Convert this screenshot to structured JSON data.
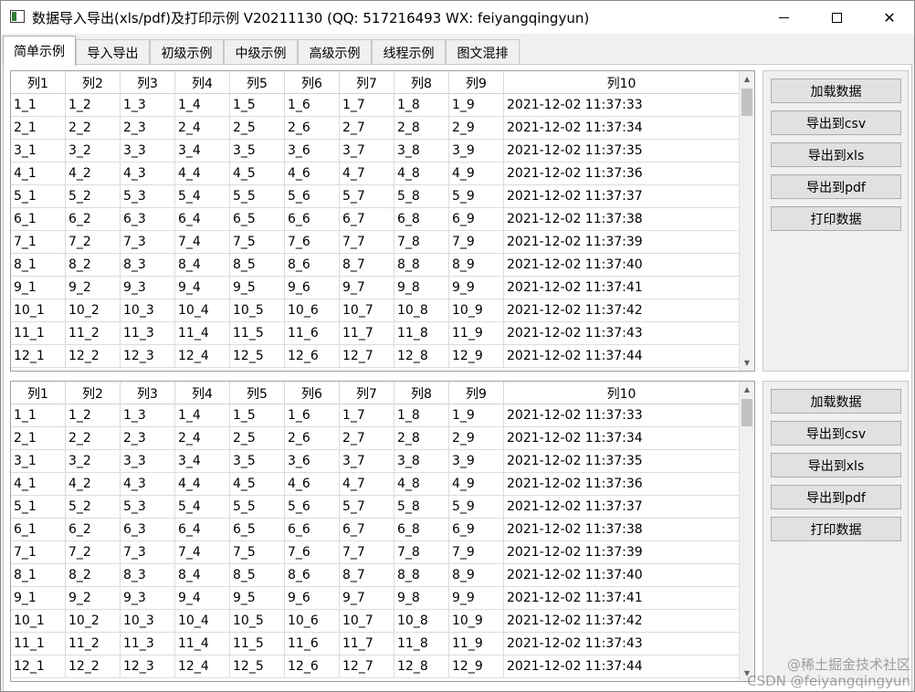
{
  "window": {
    "title": "数据导入导出(xls/pdf)及打印示例 V20211130 (QQ: 517216493 WX: feiyangqingyun)",
    "icon": "app-window-icon",
    "controls": {
      "minimize": "minimize-icon",
      "maximize": "maximize-icon",
      "close": "✕"
    }
  },
  "tabs": [
    {
      "label": "简单示例",
      "active": true
    },
    {
      "label": "导入导出",
      "active": false
    },
    {
      "label": "初级示例",
      "active": false
    },
    {
      "label": "中级示例",
      "active": false
    },
    {
      "label": "高级示例",
      "active": false
    },
    {
      "label": "线程示例",
      "active": false
    },
    {
      "label": "图文混排",
      "active": false
    }
  ],
  "tables": [
    {
      "columns": [
        "列1",
        "列2",
        "列3",
        "列4",
        "列5",
        "列6",
        "列7",
        "列8",
        "列9",
        "列10"
      ],
      "rows": [
        [
          "1_1",
          "1_2",
          "1_3",
          "1_4",
          "1_5",
          "1_6",
          "1_7",
          "1_8",
          "1_9",
          "2021-12-02 11:37:33"
        ],
        [
          "2_1",
          "2_2",
          "2_3",
          "2_4",
          "2_5",
          "2_6",
          "2_7",
          "2_8",
          "2_9",
          "2021-12-02 11:37:34"
        ],
        [
          "3_1",
          "3_2",
          "3_3",
          "3_4",
          "3_5",
          "3_6",
          "3_7",
          "3_8",
          "3_9",
          "2021-12-02 11:37:35"
        ],
        [
          "4_1",
          "4_2",
          "4_3",
          "4_4",
          "4_5",
          "4_6",
          "4_7",
          "4_8",
          "4_9",
          "2021-12-02 11:37:36"
        ],
        [
          "5_1",
          "5_2",
          "5_3",
          "5_4",
          "5_5",
          "5_6",
          "5_7",
          "5_8",
          "5_9",
          "2021-12-02 11:37:37"
        ],
        [
          "6_1",
          "6_2",
          "6_3",
          "6_4",
          "6_5",
          "6_6",
          "6_7",
          "6_8",
          "6_9",
          "2021-12-02 11:37:38"
        ],
        [
          "7_1",
          "7_2",
          "7_3",
          "7_4",
          "7_5",
          "7_6",
          "7_7",
          "7_8",
          "7_9",
          "2021-12-02 11:37:39"
        ],
        [
          "8_1",
          "8_2",
          "8_3",
          "8_4",
          "8_5",
          "8_6",
          "8_7",
          "8_8",
          "8_9",
          "2021-12-02 11:37:40"
        ],
        [
          "9_1",
          "9_2",
          "9_3",
          "9_4",
          "9_5",
          "9_6",
          "9_7",
          "9_8",
          "9_9",
          "2021-12-02 11:37:41"
        ],
        [
          "10_1",
          "10_2",
          "10_3",
          "10_4",
          "10_5",
          "10_6",
          "10_7",
          "10_8",
          "10_9",
          "2021-12-02 11:37:42"
        ],
        [
          "11_1",
          "11_2",
          "11_3",
          "11_4",
          "11_5",
          "11_6",
          "11_7",
          "11_8",
          "11_9",
          "2021-12-02 11:37:43"
        ],
        [
          "12_1",
          "12_2",
          "12_3",
          "12_4",
          "12_5",
          "12_6",
          "12_7",
          "12_8",
          "12_9",
          "2021-12-02 11:37:44"
        ]
      ],
      "buttons": [
        "加载数据",
        "导出到csv",
        "导出到xls",
        "导出到pdf",
        "打印数据"
      ]
    },
    {
      "columns": [
        "列1",
        "列2",
        "列3",
        "列4",
        "列5",
        "列6",
        "列7",
        "列8",
        "列9",
        "列10"
      ],
      "rows": [
        [
          "1_1",
          "1_2",
          "1_3",
          "1_4",
          "1_5",
          "1_6",
          "1_7",
          "1_8",
          "1_9",
          "2021-12-02 11:37:33"
        ],
        [
          "2_1",
          "2_2",
          "2_3",
          "2_4",
          "2_5",
          "2_6",
          "2_7",
          "2_8",
          "2_9",
          "2021-12-02 11:37:34"
        ],
        [
          "3_1",
          "3_2",
          "3_3",
          "3_4",
          "3_5",
          "3_6",
          "3_7",
          "3_8",
          "3_9",
          "2021-12-02 11:37:35"
        ],
        [
          "4_1",
          "4_2",
          "4_3",
          "4_4",
          "4_5",
          "4_6",
          "4_7",
          "4_8",
          "4_9",
          "2021-12-02 11:37:36"
        ],
        [
          "5_1",
          "5_2",
          "5_3",
          "5_4",
          "5_5",
          "5_6",
          "5_7",
          "5_8",
          "5_9",
          "2021-12-02 11:37:37"
        ],
        [
          "6_1",
          "6_2",
          "6_3",
          "6_4",
          "6_5",
          "6_6",
          "6_7",
          "6_8",
          "6_9",
          "2021-12-02 11:37:38"
        ],
        [
          "7_1",
          "7_2",
          "7_3",
          "7_4",
          "7_5",
          "7_6",
          "7_7",
          "7_8",
          "7_9",
          "2021-12-02 11:37:39"
        ],
        [
          "8_1",
          "8_2",
          "8_3",
          "8_4",
          "8_5",
          "8_6",
          "8_7",
          "8_8",
          "8_9",
          "2021-12-02 11:37:40"
        ],
        [
          "9_1",
          "9_2",
          "9_3",
          "9_4",
          "9_5",
          "9_6",
          "9_7",
          "9_8",
          "9_9",
          "2021-12-02 11:37:41"
        ],
        [
          "10_1",
          "10_2",
          "10_3",
          "10_4",
          "10_5",
          "10_6",
          "10_7",
          "10_8",
          "10_9",
          "2021-12-02 11:37:42"
        ],
        [
          "11_1",
          "11_2",
          "11_3",
          "11_4",
          "11_5",
          "11_6",
          "11_7",
          "11_8",
          "11_9",
          "2021-12-02 11:37:43"
        ],
        [
          "12_1",
          "12_2",
          "12_3",
          "12_4",
          "12_5",
          "12_6",
          "12_7",
          "12_8",
          "12_9",
          "2021-12-02 11:37:44"
        ]
      ],
      "buttons": [
        "加载数据",
        "导出到csv",
        "导出到xls",
        "导出到pdf",
        "打印数据"
      ]
    }
  ],
  "scrollbar": {
    "up_arrow": "▲",
    "down_arrow": "▼"
  },
  "watermark": {
    "line1": "@稀土掘金技术社区",
    "line2": "CSDN @feiyangqingyun"
  },
  "colors": {
    "window_bg": "#f0f0f0",
    "table_bg": "#ffffff",
    "button_bg": "#e1e1e1",
    "grid_line": "#dcdcdc"
  }
}
